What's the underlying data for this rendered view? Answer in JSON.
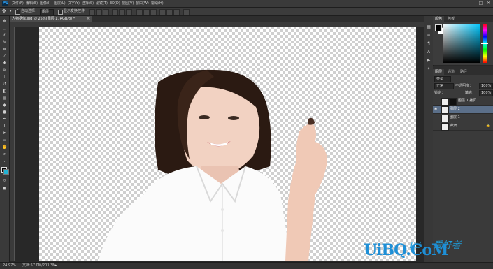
{
  "app": {
    "logo": "Ps"
  },
  "menu": {
    "items": [
      "文件(F)",
      "编辑(E)",
      "图像(I)",
      "图层(L)",
      "文字(Y)",
      "选择(S)",
      "滤镜(T)",
      "3D(D)",
      "视图(V)",
      "窗口(W)",
      "帮助(H)"
    ]
  },
  "window_controls": [
    "–",
    "□",
    "✕"
  ],
  "options": {
    "auto_select_label": "自动选择：",
    "auto_select_value": "图层",
    "transform_label": "显示变换控件"
  },
  "document": {
    "tab_title": "人物抠像.jpg @ 25%(图层 1, RGB/8) *",
    "close": "×"
  },
  "status": {
    "zoom": "24.97%",
    "doc_info": "文档:57.0M/203.3M"
  },
  "color_panel": {
    "tabs": [
      "颜色",
      "色板"
    ]
  },
  "layers_panel": {
    "tabs": [
      "图层",
      "通道",
      "路径"
    ],
    "filter_label": "类型",
    "blend_mode": "正常",
    "opacity_label": "不透明度：",
    "opacity": "100%",
    "lock_label": "锁定：",
    "fill_label": "填充：",
    "fill": "100%",
    "layers": [
      {
        "name": "图层 1 拷贝",
        "visible": false,
        "selected": false,
        "mask": true
      },
      {
        "name": "图层 2",
        "visible": true,
        "selected": true,
        "mask": false
      },
      {
        "name": "图层 1",
        "visible": false,
        "selected": false,
        "mask": false
      },
      {
        "name": "背景",
        "visible": false,
        "selected": false,
        "mask": false,
        "locked": true
      }
    ]
  },
  "watermark": {
    "main": "UiBQ.CoM",
    "ps": "PS",
    "cn": "爱好者"
  },
  "colors": {
    "selected_layer": "#5b6f89",
    "accent_blue": "#1e8fd6"
  }
}
